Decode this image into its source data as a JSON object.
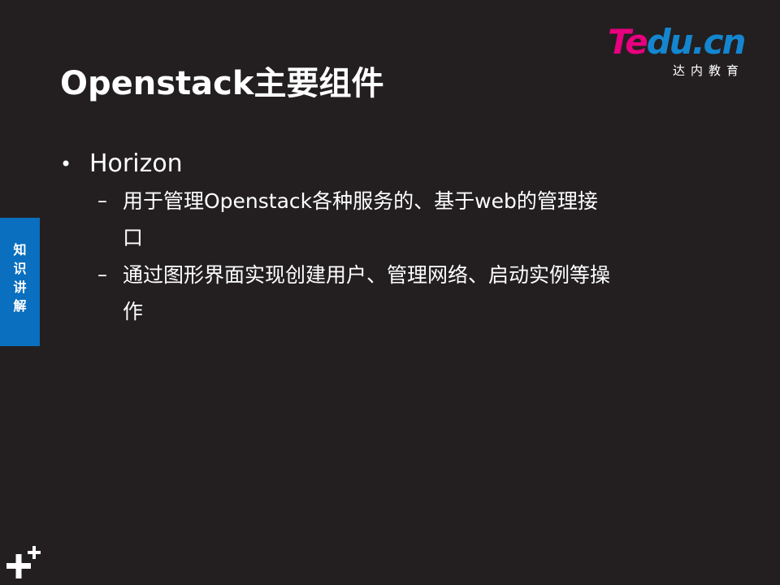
{
  "slide": {
    "title": "Openstack主要组件"
  },
  "logo": {
    "brand_part1": "Te",
    "brand_part2": "du.cn",
    "subtitle": "达内教育"
  },
  "side_tab": {
    "chars": [
      "知",
      "识",
      "讲",
      "解"
    ]
  },
  "content": {
    "bullet": "Horizon",
    "sub_bullets": [
      "用于管理Openstack各种服务的、基于web的管理接口",
      "通过图形界面实现创建用户、管理网络、启动实例等操作"
    ],
    "bullet_symbol": "•",
    "sub_bullet_symbol": "–"
  },
  "colors": {
    "background": "#231f20",
    "side_tab": "#0a6fbe",
    "logo_pink": "#e6007e",
    "logo_blue": "#1486d0",
    "text": "#ffffff"
  },
  "icons": {
    "corner": "plus-cross-icon"
  }
}
